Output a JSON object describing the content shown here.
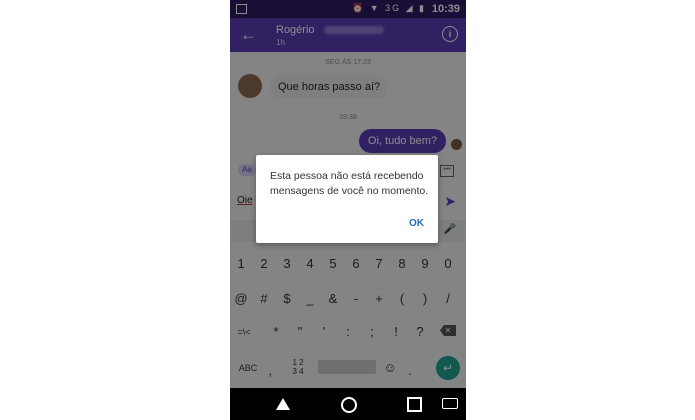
{
  "status_bar": {
    "network": "3G",
    "time": "10:39"
  },
  "header": {
    "contact_name": "Rogério",
    "last_seen": "1h"
  },
  "chat": {
    "timestamp_1": "SEG ÀS 17:23",
    "incoming_message": "Que horas passo aí?",
    "timestamp_2": "09:38",
    "outgoing_message": "Oi, tudo bem?"
  },
  "compose": {
    "aa_label": "Aa",
    "draft_text": "Oie"
  },
  "keyboard": {
    "row1": [
      "1",
      "2",
      "3",
      "4",
      "5",
      "6",
      "7",
      "8",
      "9",
      "0"
    ],
    "row2": [
      "@",
      "#",
      "$",
      "_",
      "&",
      "-",
      "+",
      "(",
      ")",
      "/"
    ],
    "row3": [
      "=\\<",
      "*",
      "\"",
      "'",
      ":",
      ";",
      "!",
      "?"
    ],
    "abc": "ABC",
    "numbers_label": "1 2\n3 4",
    "comma": ",",
    "period": "."
  },
  "dialog": {
    "message": "Esta pessoa não está recebendo mensagens de você no momento.",
    "ok_label": "OK"
  },
  "colors": {
    "brand": "#5a3db4",
    "status_bar": "#2d1a63",
    "enter_key": "#1fa191",
    "dialog_button": "#1f6fc0"
  }
}
